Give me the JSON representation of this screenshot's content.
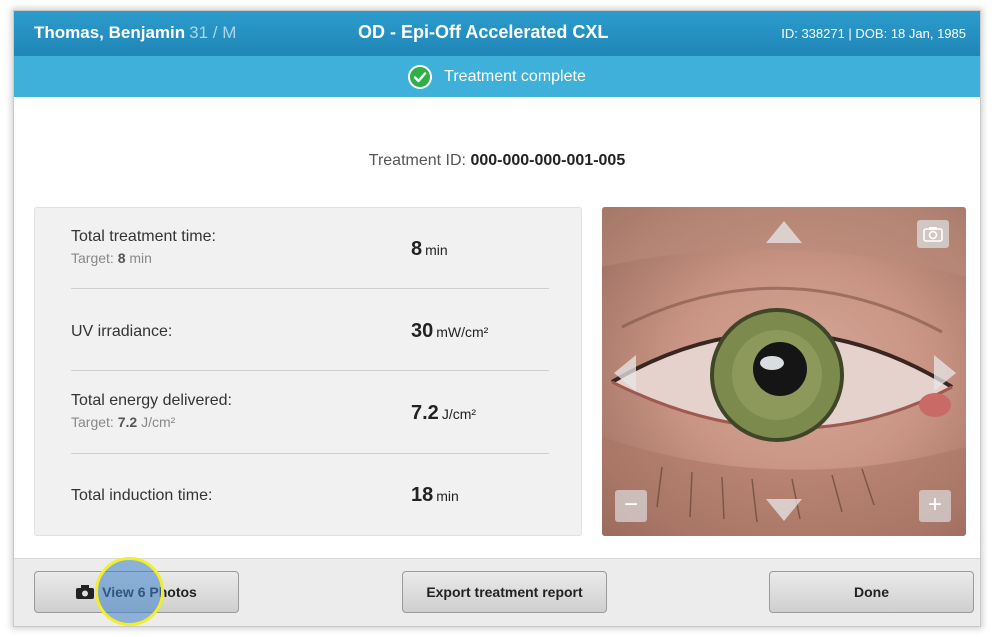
{
  "header": {
    "patient_name": "Thomas, Benjamin",
    "patient_age_sex": "31 / M",
    "procedure": "OD - Epi-Off Accelerated CXL",
    "patient_info": "ID: 338271 | DOB: 18 Jan, 1985"
  },
  "status": {
    "text": "Treatment complete",
    "icon": "check-circle-icon",
    "color": "#3fb0d9"
  },
  "treatment_id": {
    "label": "Treatment ID:",
    "value": "000-000-000-001-005"
  },
  "stats": [
    {
      "label": "Total treatment time:",
      "target_label": "Target:",
      "target_value": "8",
      "target_unit": "min",
      "value": "8",
      "unit": "min"
    },
    {
      "label": "UV irradiance:",
      "value": "30",
      "unit": "mW/cm²"
    },
    {
      "label": "Total energy delivered:",
      "target_label": "Target:",
      "target_value": "7.2",
      "target_unit": "J/cm²",
      "value": "7.2",
      "unit": "J/cm²"
    },
    {
      "label": "Total induction time:",
      "value": "18",
      "unit": "min"
    }
  ],
  "camera": {
    "controls": {
      "up": "up-arrow-icon",
      "down": "down-arrow-icon",
      "left": "left-arrow-icon",
      "right": "right-arrow-icon",
      "snapshot": "camera-icon",
      "zoom_out": "−",
      "zoom_in": "+"
    }
  },
  "footer": {
    "photos_label": "View 6 Photos",
    "export_label": "Export treatment report",
    "done_label": "Done"
  },
  "colors": {
    "header": "#2c9ccd",
    "status_bar": "#3fb0d9",
    "success": "#2fae4a"
  }
}
